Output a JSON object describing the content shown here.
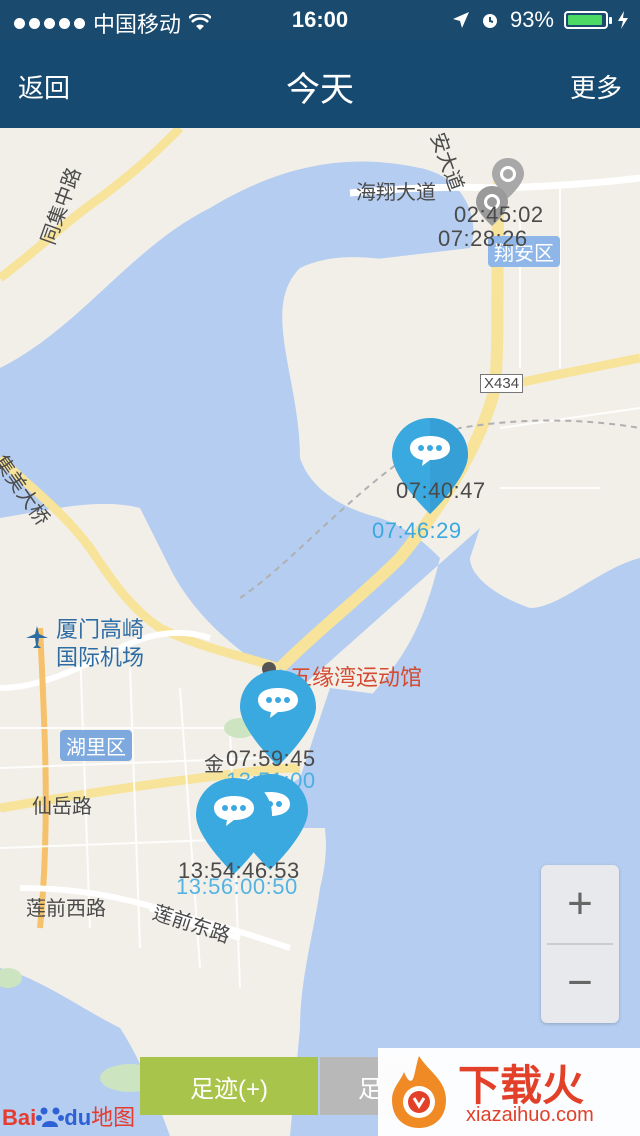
{
  "status_bar": {
    "carrier": "中国移动",
    "time": "16:00",
    "battery": "93%",
    "battery_level": 0.93
  },
  "nav": {
    "back_label": "返回",
    "title": "今天",
    "more_label": "更多"
  },
  "map": {
    "road_labels": [
      "同集中路",
      "海翔大道",
      "X434",
      "集美大桥",
      "仙岳路",
      "莲前西路",
      "莲前东路",
      "安大道",
      "金"
    ],
    "district_labels": [
      "翔安区",
      "湖里区"
    ],
    "airport_label": [
      "厦门高崎",
      "国际机场"
    ],
    "poi_label": "五缘湾运动馆",
    "markers": [
      {
        "time_gray": "02:45:02",
        "time_gray_b": "07:28:26",
        "color": "gray"
      },
      {
        "time_gray": "07:40:47",
        "time_blue": "07:46:29",
        "color": "blue"
      },
      {
        "time_gray": "07:59:45",
        "time_blue": "13:51:00",
        "color": "blue"
      },
      {
        "time_gray": "13:54:46:53",
        "time_blue": "13:56:00:50",
        "color": "blue"
      }
    ]
  },
  "zoom": {
    "in_label": "+",
    "out_label": "−"
  },
  "buttons": {
    "footprint_add": "足迹(+)",
    "footprint_second": "足"
  },
  "branding": {
    "baidu_bai": "Bai",
    "baidu_du": "du",
    "baidu_map": "地图"
  },
  "watermark": {
    "text": "下载火",
    "url": "xiazaihuo.com"
  },
  "colors": {
    "nav_bg": "#164a70",
    "water": "#b4cdf0",
    "land": "#f2efe9",
    "road": "#f7e39a",
    "marker_blue": "#3aa9e0",
    "marker_gray": "#a8a8a8",
    "button_green": "#a9c44a"
  }
}
